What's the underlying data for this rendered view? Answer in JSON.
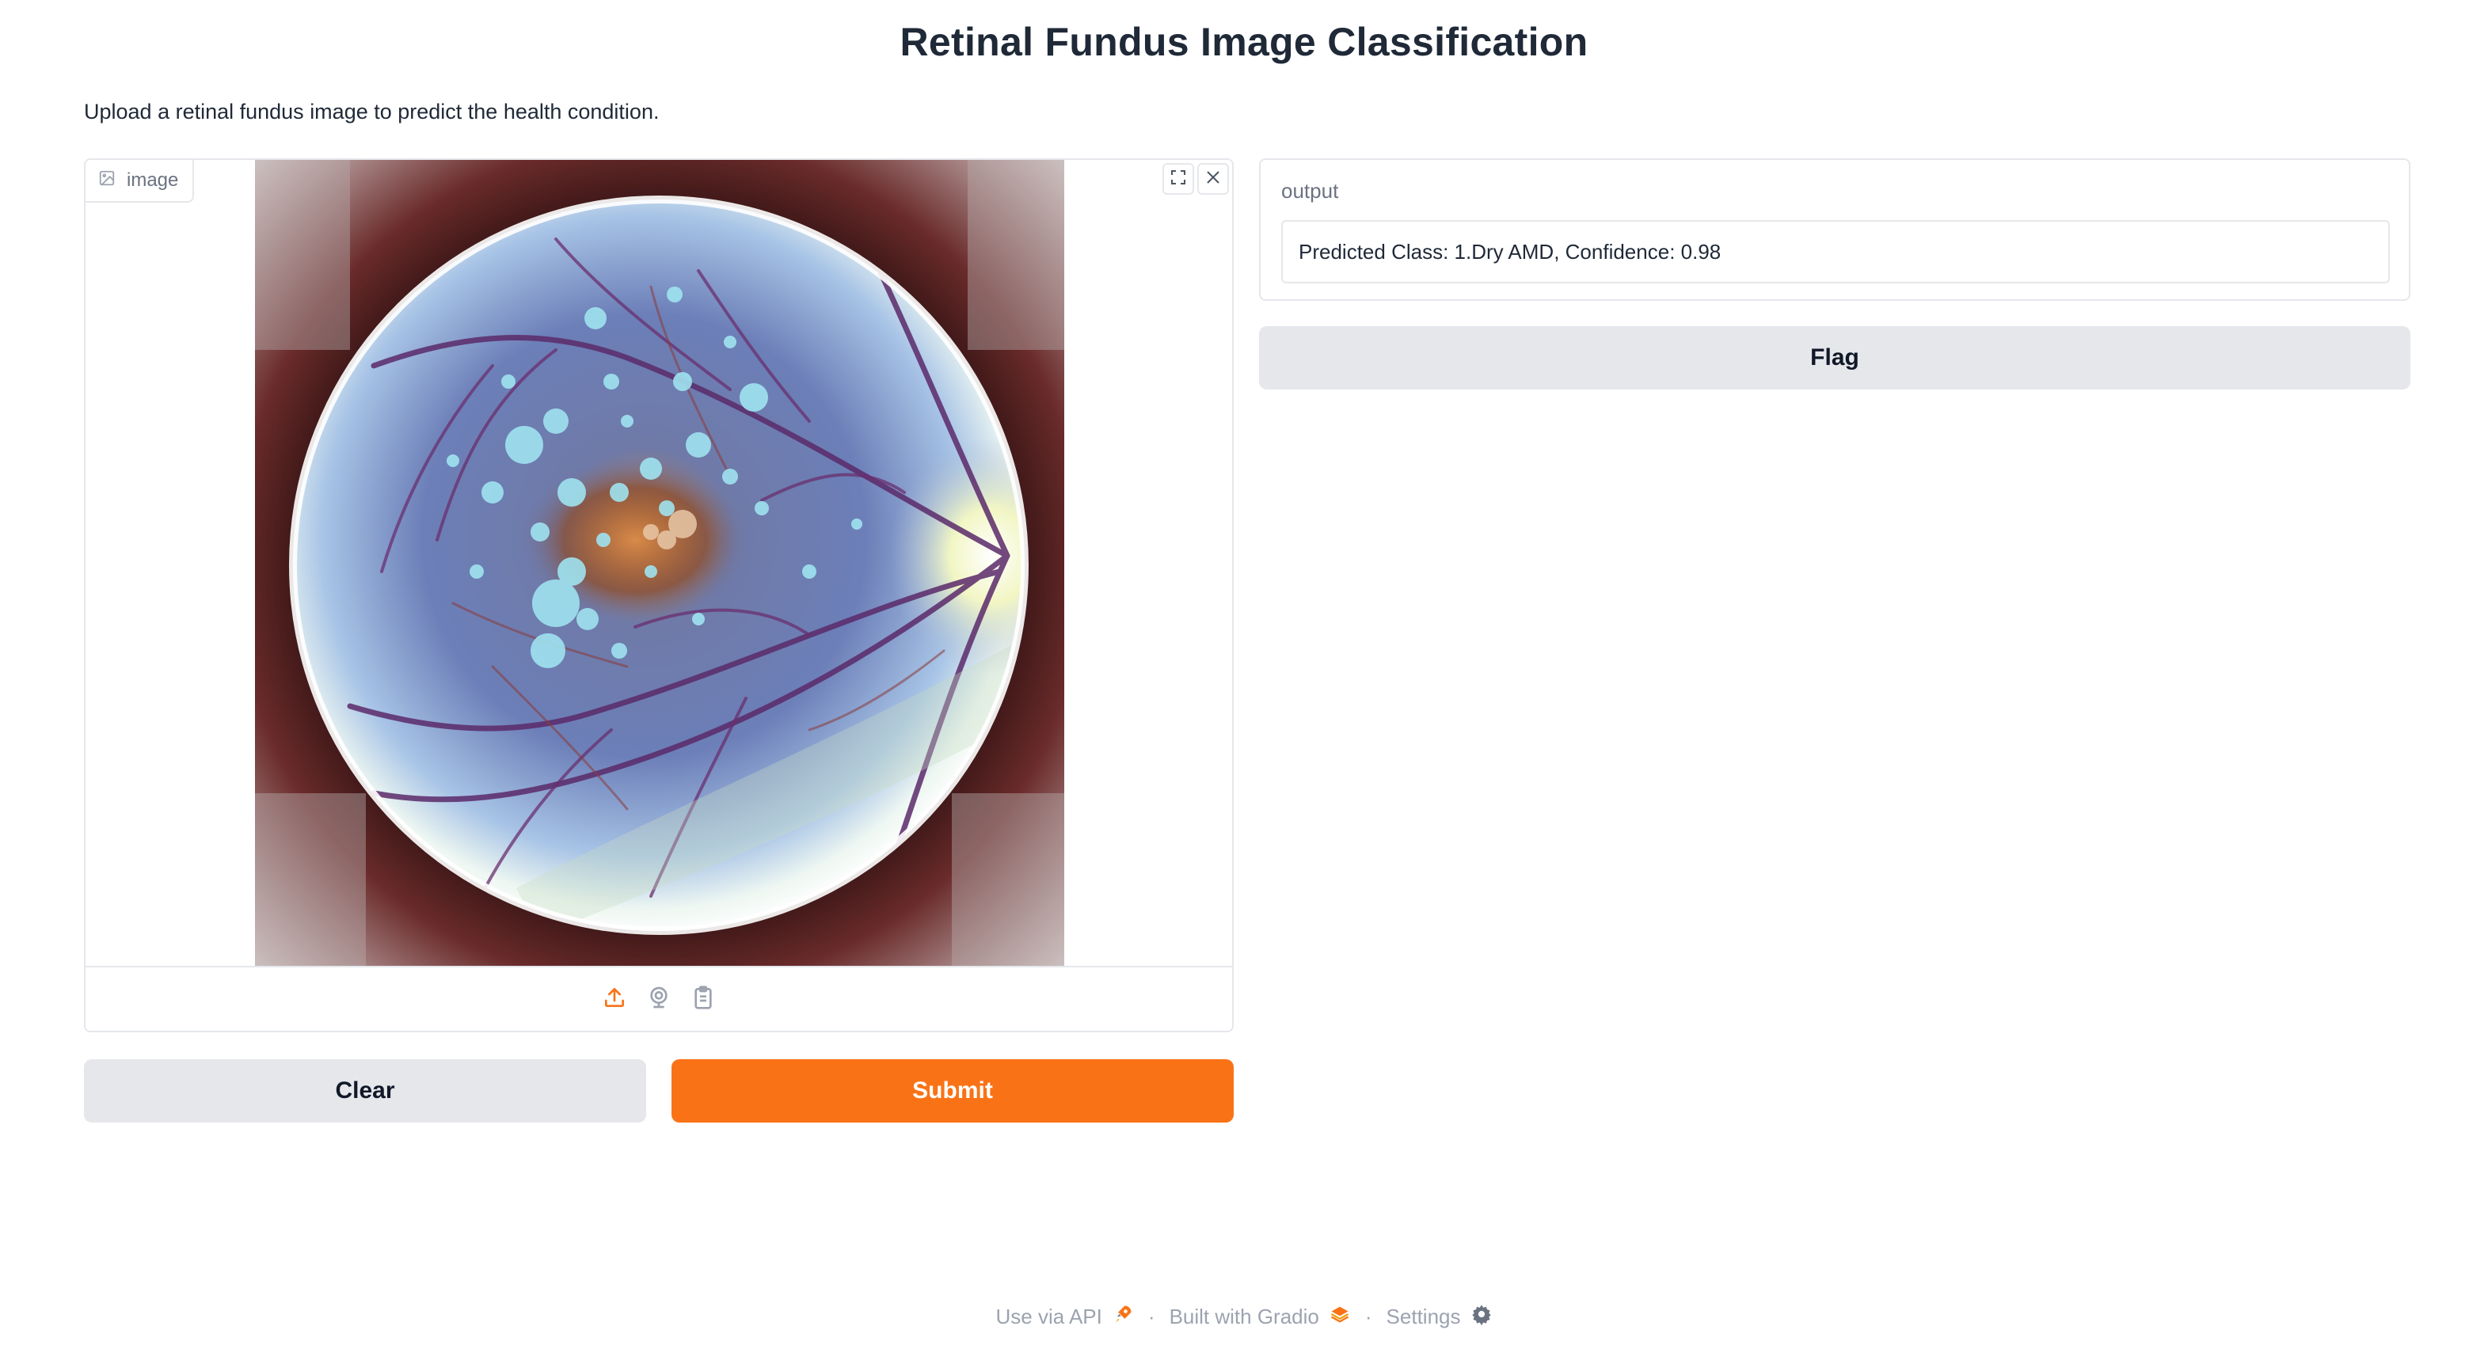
{
  "page": {
    "title": "Retinal Fundus Image Classification",
    "description": "Upload a retinal fundus image to predict the health condition."
  },
  "image_input": {
    "label": "image",
    "label_icon": "image-icon",
    "tools": [
      {
        "name": "fullscreen-icon"
      },
      {
        "name": "close-icon"
      }
    ],
    "sources": [
      {
        "name": "upload-icon",
        "active": true
      },
      {
        "name": "webcam-icon",
        "active": false
      },
      {
        "name": "clipboard-icon",
        "active": false
      }
    ]
  },
  "output": {
    "label": "output",
    "value": "Predicted Class: 1.Dry AMD, Confidence: 0.98"
  },
  "buttons": {
    "clear": "Clear",
    "submit": "Submit",
    "flag": "Flag"
  },
  "footer": {
    "api": "Use via API",
    "built": "Built with Gradio",
    "settings": "Settings",
    "separator": "·"
  },
  "colors": {
    "accent": "#f97316",
    "button_secondary": "#e5e7eb",
    "border": "#e5e7eb",
    "muted_text": "#9ca3af"
  }
}
